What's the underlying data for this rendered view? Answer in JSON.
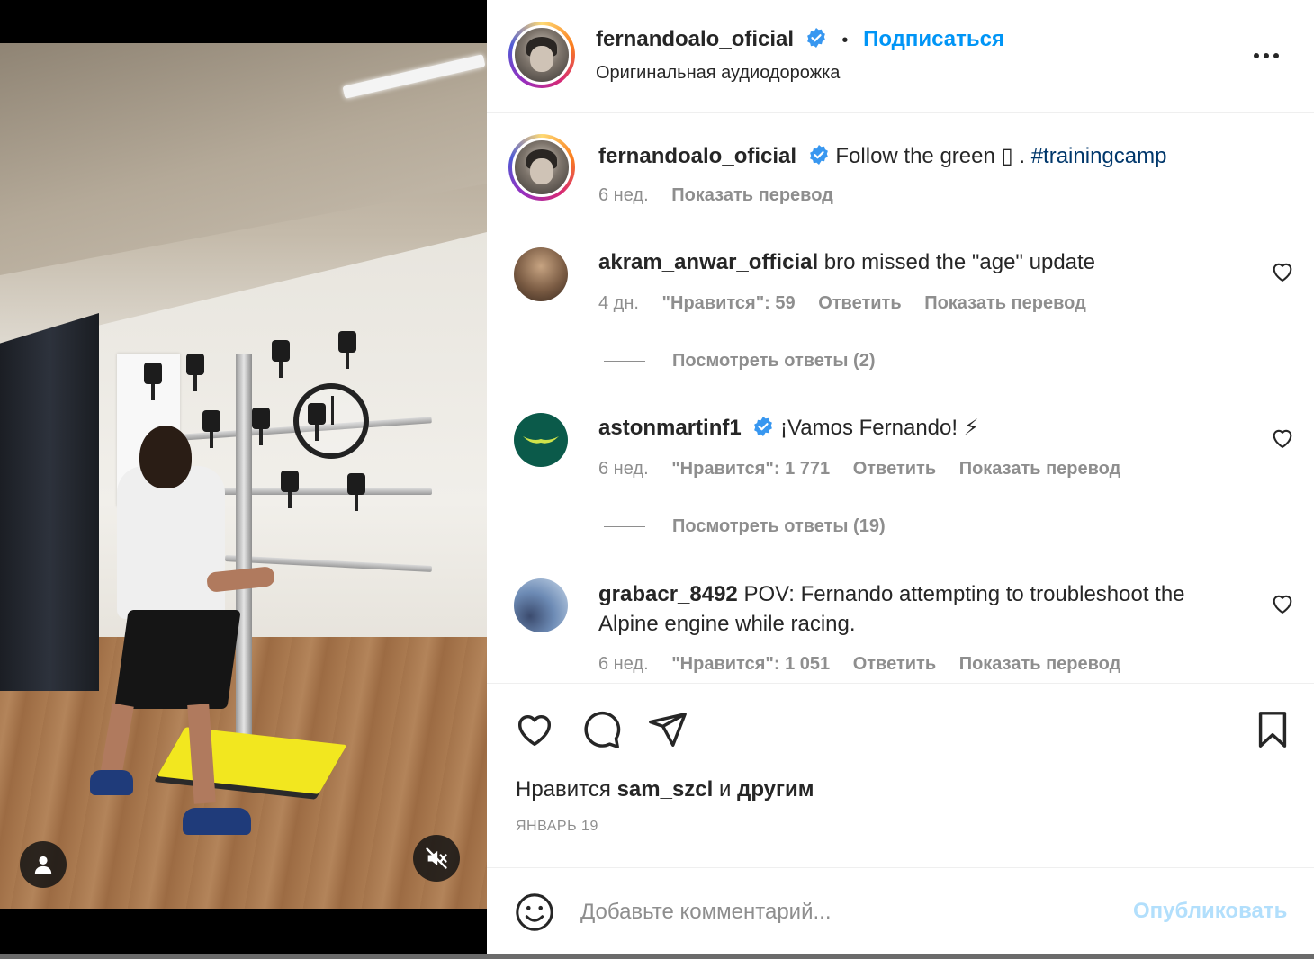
{
  "post_header": {
    "username": "fernandoalo_oficial",
    "separator": "•",
    "follow_label": "Подписаться",
    "audio_label": "Оригинальная аудиодорожка"
  },
  "caption": {
    "username": "fernandoalo_oficial",
    "text": "Follow the green ▯ . ",
    "hashtag": "#trainingcamp",
    "time": "6 нед.",
    "translate": "Показать перевод"
  },
  "comments": [
    {
      "username": "akram_anwar_official",
      "text": "bro missed the \"age\" update",
      "time": "4 дн.",
      "likes": "\"Нравится\": 59",
      "reply": "Ответить",
      "translate": "Показать перевод",
      "view_replies": "Посмотреть ответы (2)"
    },
    {
      "username": "astonmartinf1",
      "text": "¡Vamos Fernando! ⚡",
      "time": "6 нед.",
      "likes": "\"Нравится\": 1 771",
      "reply": "Ответить",
      "translate": "Показать перевод",
      "view_replies": "Посмотреть ответы (19)"
    },
    {
      "username": "grabacr_8492",
      "text_line1": "POV: Fernando attempting to troubleshoot the",
      "text_line2": "Alpine engine while racing.",
      "time": "6 нед.",
      "likes": "\"Нравится\": 1 051",
      "reply": "Ответить",
      "translate": "Показать перевод"
    }
  ],
  "likes_summary": {
    "prefix": "Нравится ",
    "user": "sam_szcl",
    "middle": " и ",
    "suffix": "другим"
  },
  "post_date": "ЯНВАРЬ 19",
  "add_comment": {
    "placeholder": "Добавьте комментарий...",
    "publish_label": "Опубликовать"
  },
  "icons": {
    "more": "more-icon",
    "heart": "heart-icon",
    "comment": "comment-icon",
    "share": "paper-plane-icon",
    "save": "bookmark-icon",
    "emoji": "emoji-icon",
    "user_tag": "user-icon",
    "mute": "speaker-muted-icon",
    "verified": "verified-badge-icon"
  },
  "colors": {
    "accent": "#0095f6",
    "verified": "#3897f0",
    "publish_disabled": "#b2dffc",
    "muted_text": "#8e8e8e"
  }
}
